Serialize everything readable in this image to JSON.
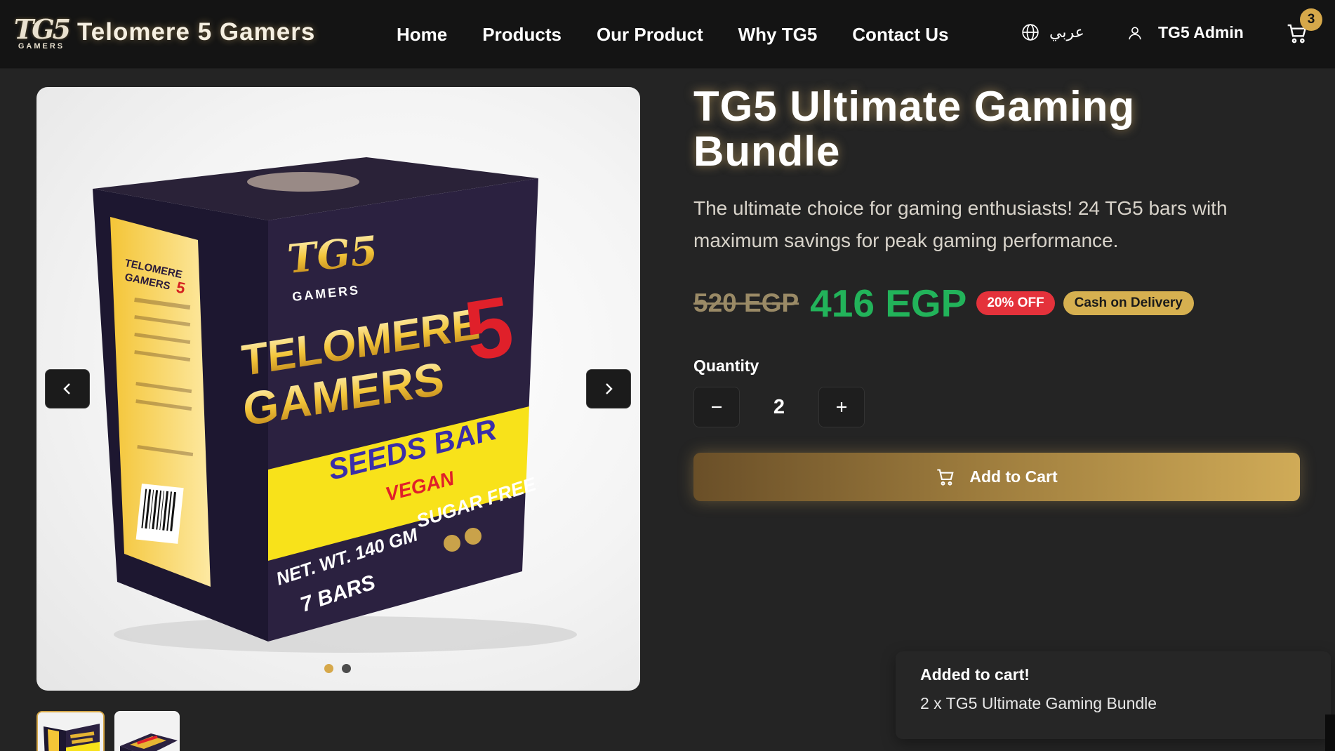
{
  "header": {
    "logo_mark": "TG5",
    "logo_sub": "GAMERS",
    "brand": "Telomere 5 Gamers",
    "nav": [
      "Home",
      "Products",
      "Our Product",
      "Why TG5",
      "Contact Us"
    ],
    "language_label": "عربي",
    "language_icon": "globe-icon",
    "user_icon": "user-icon",
    "user_label": "TG5 Admin",
    "cart_icon": "cart-icon",
    "cart_count": "3"
  },
  "gallery": {
    "prev_icon": "chevron-left-icon",
    "next_icon": "chevron-right-icon",
    "slide_count": 2,
    "active_slide": 1,
    "thumbnail_count": 2,
    "active_thumbnail": 1,
    "image_text": {
      "logo": "TG5",
      "logo_sub": "GAMERS",
      "brand_line1": "TELOMERE",
      "brand_line2": "GAMERS",
      "brand_num": "5",
      "band_line1": "SEEDS BAR",
      "band_line2": "VEGAN",
      "weight": "NET. WT. 140 GM",
      "bars": "7 BARS",
      "sugar": "SUGAR FREE",
      "side_brand_1": "TELOMERE",
      "side_brand_2": "GAMERS",
      "side_brand_num": "5"
    }
  },
  "product": {
    "title": "TG5 Ultimate Gaming Bundle",
    "description": "The ultimate choice for gaming enthusiasts! 24 TG5 bars with maximum savings for peak gaming performance.",
    "old_price": "520 EGP",
    "new_price": "416 EGP",
    "discount_badge": "20% OFF",
    "payment_badge": "Cash on Delivery",
    "quantity_label": "Quantity",
    "quantity": "2",
    "add_to_cart_label": "Add to Cart"
  },
  "toast": {
    "title": "Added to cart!",
    "message": "2 x TG5 Ultimate Gaming Bundle"
  },
  "colors": {
    "background": "#242424",
    "header": "#141414",
    "accent_gold": "#d6a84a",
    "price_green": "#22b35a",
    "discount_red": "#e4323b"
  }
}
